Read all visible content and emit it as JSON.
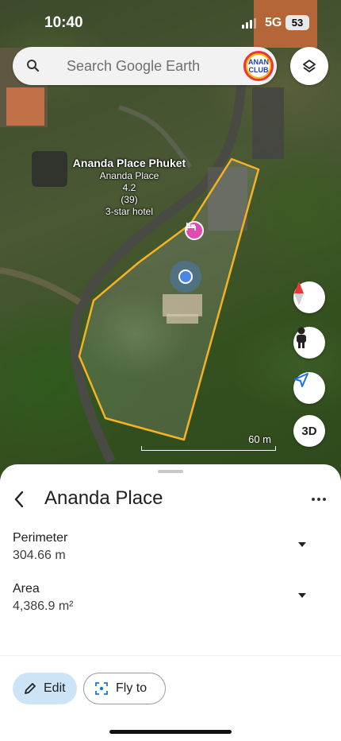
{
  "status_bar": {
    "time": "10:40",
    "network": "5G",
    "battery": "53"
  },
  "search": {
    "placeholder": "Search Google Earth"
  },
  "avatar": {
    "line1": "ANAN",
    "line2": "CLUB"
  },
  "place_label": {
    "name": "Ananda Place Phuket",
    "subtitle": "Ananda Place",
    "rating": "4.2",
    "reviews": "(39)",
    "category": "3-star hotel"
  },
  "map_controls": {
    "three_d_label": "3D"
  },
  "scale": {
    "label": "60 m"
  },
  "sheet": {
    "title": "Ananda Place",
    "perimeter": {
      "label": "Perimeter",
      "value": "304.66 m"
    },
    "area": {
      "label": "Area",
      "value": "4,386.9 m²"
    },
    "edit_label": "Edit",
    "fly_to_label": "Fly to"
  },
  "colors": {
    "polygon": "#f5b324",
    "edit_bg": "#cde3f6",
    "hotel_pin": "#e24ab1",
    "location": "#4a86e8"
  },
  "icons": [
    "search-icon",
    "layers-icon",
    "compass-icon",
    "pegman-icon",
    "my-location-icon",
    "hotel-icon",
    "back-arrow-icon",
    "more-vert-icon",
    "pencil-icon",
    "fly-to-icon",
    "chevron-down-icon"
  ]
}
